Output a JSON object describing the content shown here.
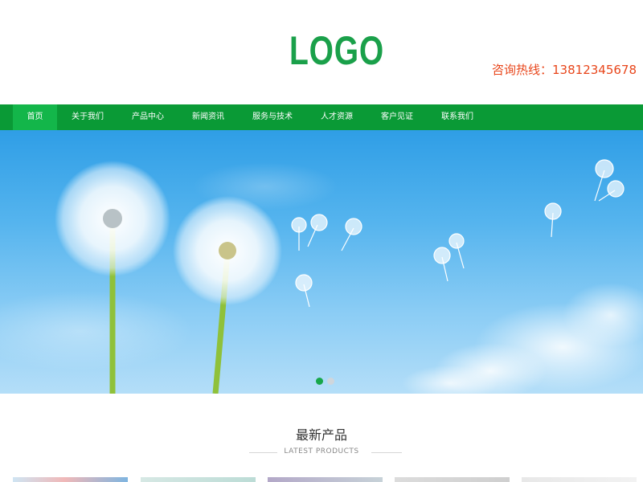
{
  "header": {
    "logo": "LOGO",
    "hotline": "咨询热线：13812345678"
  },
  "nav": {
    "items": [
      {
        "label": "首页",
        "active": true
      },
      {
        "label": "关于我们"
      },
      {
        "label": "产品中心"
      },
      {
        "label": "新闻资讯"
      },
      {
        "label": "服务与技术"
      },
      {
        "label": "人才资源"
      },
      {
        "label": "客户见证"
      },
      {
        "label": "联系我们"
      }
    ]
  },
  "banner": {
    "slides": 2,
    "active_slide": 1
  },
  "products_section": {
    "title": "最新产品",
    "subtitle": "LATEST PRODUCTS"
  },
  "colors": {
    "brand_green": "#0a9a36",
    "nav_active": "#13b64a",
    "hotline_red": "#e8461b"
  }
}
